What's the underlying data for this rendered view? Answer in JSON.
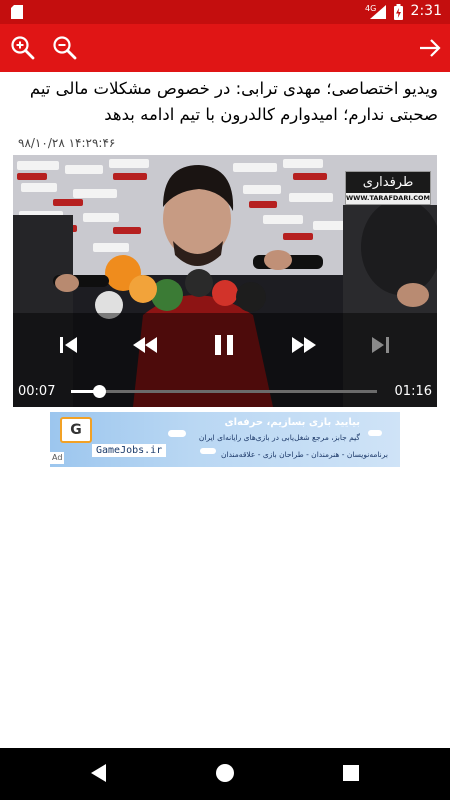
{
  "status_bar": {
    "time": "2:31",
    "network": "4G",
    "icons": [
      "sd-card-icon",
      "signal-icon",
      "battery-charging-icon"
    ]
  },
  "toolbar": {
    "icons": [
      "zoom-in-icon",
      "zoom-out-icon",
      "arrow-forward-icon"
    ]
  },
  "article": {
    "title": "ویدیو اختصاصی؛ مهدی ترابی: در خصوص مشکلات مالی تیم صحبتی ندارم؛ امیدوارم کالدرون با تیم ادامه بدهد",
    "date": "۹۸/۱۰/۲۸ ۱۴:۲۹:۴۶"
  },
  "video": {
    "watermark_title": "طرفداری",
    "watermark_url": "WWW.TARAFDARI.COM",
    "current_time": "00:07",
    "total_time": "01:16",
    "progress": 0.092,
    "controls": [
      "skip-previous-icon",
      "rewind-icon",
      "pause-icon",
      "fast-forward-icon",
      "skip-next-icon"
    ]
  },
  "ad": {
    "badge": "Ad",
    "logo_letter": "G",
    "site": "GameJobs.ir",
    "heading": "بیایید بازی بسازیم، حرفه‌ای",
    "subtitle": "گیم جابز، مرجع شغل‌یابی در بازی‌های رایانه‌ای ایران",
    "roles": "برنامه‌نویسان - هنرمندان - طراحان بازی - علاقه‌مندان"
  },
  "nav_bar": {
    "icons": [
      "back-triangle-icon",
      "home-circle-icon",
      "recents-square-icon"
    ]
  }
}
